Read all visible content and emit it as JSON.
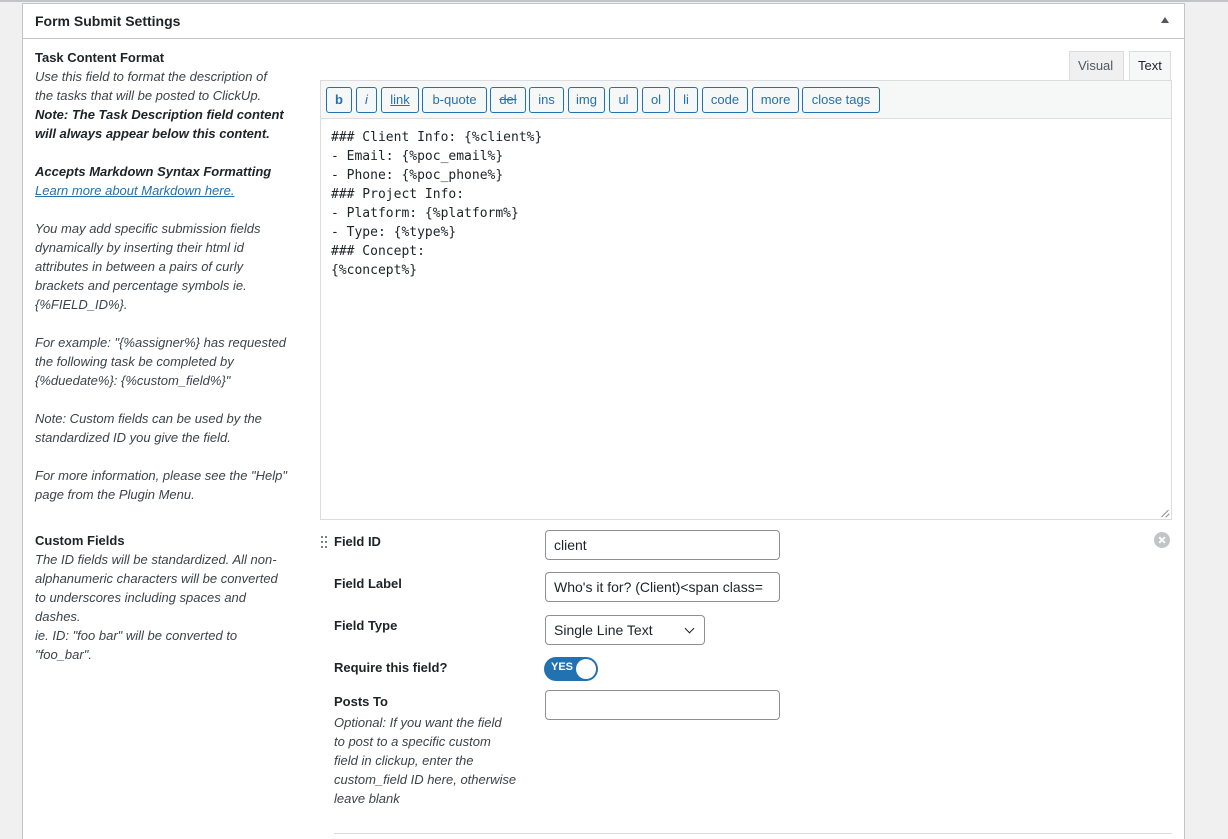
{
  "panel": {
    "title": "Form Submit Settings"
  },
  "task_content": {
    "title": "Task Content Format",
    "desc_lines": [
      "Use this field to format the description of",
      "the tasks that will be posted to ClickUp."
    ],
    "note_lines": [
      "Note: The Task Description field content",
      "will always appear below this content."
    ],
    "markdown_heading": "Accepts Markdown Syntax Formatting",
    "markdown_link": "Learn more about Markdown here.",
    "fields_lines": [
      "You may add specific submission fields",
      "dynamically by inserting their html id",
      "attributes in between a pairs of curly",
      "brackets and percentage symbols ie.",
      "{%FIELD_ID%}."
    ],
    "example_lines": [
      "For example: \"{%assigner%} has requested",
      "the following task be completed by",
      "{%duedate%}: {%custom_field%}\""
    ],
    "custom_note_lines": [
      "Note: Custom fields can be used by the",
      "standardized ID you give the field."
    ],
    "help_lines": [
      "For more information, please see the \"Help\"",
      "page from the Plugin Menu."
    ]
  },
  "custom_fields": {
    "title": "Custom Fields",
    "desc_lines": [
      "The ID fields will be standardized. All non-",
      "alphanumeric characters will be converted",
      "to underscores including spaces and",
      "dashes.",
      "ie. ID: \"foo bar\" will be converted to",
      "\"foo_bar\"."
    ]
  },
  "editor": {
    "tabs": {
      "visual": "Visual",
      "text": "Text"
    },
    "buttons": [
      "b",
      "i",
      "link",
      "b-quote",
      "del",
      "ins",
      "img",
      "ul",
      "ol",
      "li",
      "code",
      "more",
      "close tags"
    ],
    "content_lines": [
      "### Client Info: {%client%}",
      "- Email: {%poc_email%}",
      "- Phone: {%poc_phone%}",
      "### Project Info:",
      "- Platform: {%platform%}",
      "- Type: {%type%}",
      "### Concept:",
      "{%concept%}"
    ]
  },
  "field": {
    "id_label": "Field ID",
    "id_value": "client",
    "label_label": "Field Label",
    "label_value": "Who's it for? (Client)<span class=",
    "type_label": "Field Type",
    "type_value": "Single Line Text",
    "require_label": "Require this field?",
    "require_value": "YES",
    "posts_label": "Posts To",
    "posts_value": "",
    "posts_help_lines": [
      "Optional: If you want the field",
      "to post to a specific custom",
      "field in clickup, enter the",
      "custom_field ID here, otherwise",
      "leave blank"
    ]
  },
  "colors": {
    "accent": "#2271b1",
    "border": "#c3c4c7",
    "background": "#f0f0f1"
  }
}
